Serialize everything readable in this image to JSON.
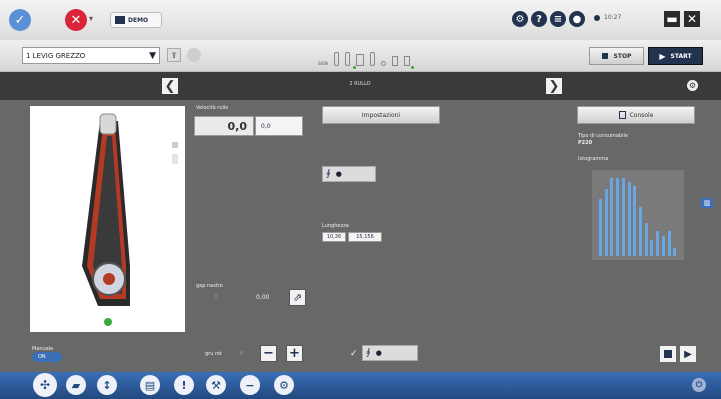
{
  "header": {
    "demo_label": "DEMO",
    "time": "10:27",
    "status_icons": [
      "gear-icon",
      "help-icon",
      "list-icon",
      "user-icon"
    ]
  },
  "toolbar": {
    "program_select": "1 LEVIG GREZZO",
    "sequence_label": "SIGN",
    "stop_label": "STOP",
    "start_label": "START"
  },
  "nav": {
    "step_title": "2 RULLO"
  },
  "left_panel": {
    "active_indicator_color": "#3aa83a"
  },
  "center": {
    "velocity_label": "Velocità rullo",
    "velocity_value": "0,0",
    "velocity_unit": "0,0",
    "settings_button": "Impostazioni",
    "params_label": "Lunghezza",
    "param_a": "10,36",
    "param_b": "15,156",
    "gap_label": "gap nastro",
    "gap_value": "0,00",
    "small_value": "0"
  },
  "right_panel": {
    "console_button": "Console",
    "info_label": "Tipo di consumabile",
    "info_value": "P220",
    "histogram_label": "Istogramma",
    "histogram_values": [
      70,
      82,
      95,
      95,
      95,
      90,
      85,
      60,
      40,
      20,
      30,
      25,
      30,
      10
    ]
  },
  "footer": {
    "toggle_label": "Manuale",
    "toggle_state": "ON",
    "step_label": "gru rot",
    "step_value": "0"
  },
  "bottom": {
    "icons": [
      "tool-icon",
      "folder-icon",
      "info-icon",
      "chart-icon",
      "alert-icon",
      "wrench-icon",
      "minus-icon",
      "settings-icon"
    ]
  }
}
